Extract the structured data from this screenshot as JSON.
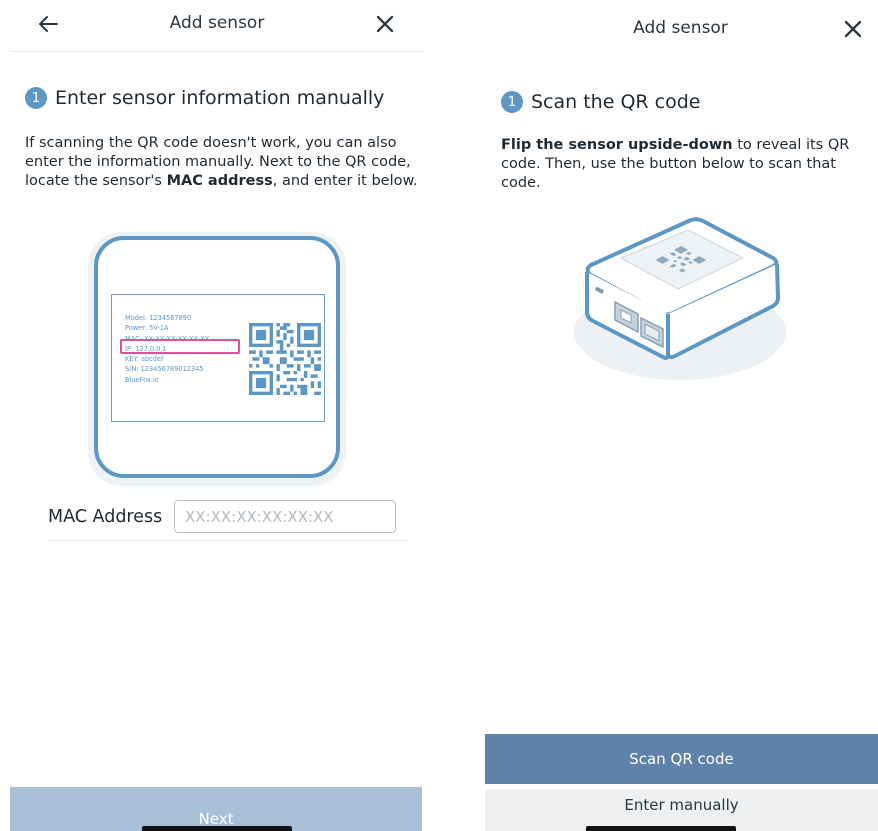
{
  "left_screen": {
    "header": {
      "title": "Add sensor"
    },
    "step": {
      "number": "1",
      "title": "Enter sensor information manually",
      "desc_part1": "If scanning the QR code doesn't work, you can also enter the information manually. Next to the QR code, locate the sensor's ",
      "desc_bold": "MAC address",
      "desc_part2": ", and enter it below."
    },
    "label_card": {
      "lines": [
        "Model: 1234567890",
        "Power: 5V-1A",
        "MAC: XX:XX:XX:XX:XX:XX",
        "IP: 127.0.0.1",
        "KEY: abcdef",
        "S/N: 123456789012345",
        "BlueFox.io"
      ]
    },
    "mac_field": {
      "label": "MAC Address",
      "placeholder": "XX:XX:XX:XX:XX:XX",
      "value": ""
    },
    "next_label": "Next"
  },
  "right_screen": {
    "header": {
      "title": "Add sensor"
    },
    "step": {
      "number": "1",
      "title": "Scan the QR code",
      "desc_bold": "Flip the sensor upside-down",
      "desc_rest": " to reveal its QR code. Then, use the button below to scan that code."
    },
    "scan_label": "Scan QR code",
    "manual_label": "Enter manually"
  },
  "colors": {
    "accent": "#5d97c6",
    "highlight": "#d9529a",
    "next_disabled": "#a7bfd7",
    "scan_button": "#5e83aa",
    "manual_button": "#eef0f2"
  },
  "icons": {
    "back": "arrow-left-icon",
    "close": "close-icon",
    "qr": "qr-code-icon",
    "sensor_device": "sensor-device-illustration"
  }
}
